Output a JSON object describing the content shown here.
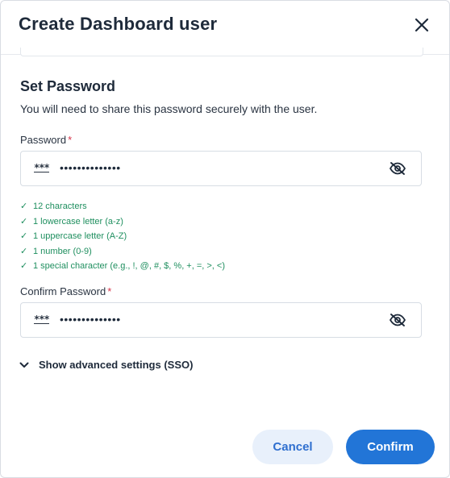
{
  "header": {
    "title": "Create Dashboard user",
    "close_icon": "close-icon"
  },
  "section": {
    "title": "Set Password",
    "description": "You will need to share this password securely with the user."
  },
  "password": {
    "label": "Password",
    "required_mark": "*",
    "value": "••••••••••••••",
    "icon_text": "***",
    "toggle_icon": "eye-slash-icon"
  },
  "requirements": [
    {
      "check": "✓",
      "text": "12 characters"
    },
    {
      "check": "✓",
      "text": "1 lowercase letter (a-z)"
    },
    {
      "check": "✓",
      "text": "1 uppercase letter (A-Z)"
    },
    {
      "check": "✓",
      "text": "1 number (0-9)"
    },
    {
      "check": "✓",
      "text": "1 special character (e.g., !, @, #, $, %, +, =, >, <)"
    }
  ],
  "confirm_password": {
    "label": "Confirm Password",
    "required_mark": "*",
    "value": "••••••••••••••",
    "icon_text": "***",
    "toggle_icon": "eye-slash-icon"
  },
  "advanced": {
    "label": "Show advanced settings (SSO)",
    "icon": "chevron-down-icon"
  },
  "actions": {
    "cancel_label": "Cancel",
    "confirm_label": "Confirm"
  },
  "colors": {
    "primary": "#2275d7",
    "cancel_bg": "#e8f0fb",
    "success": "#1f8f5f",
    "required": "#d6334a"
  }
}
